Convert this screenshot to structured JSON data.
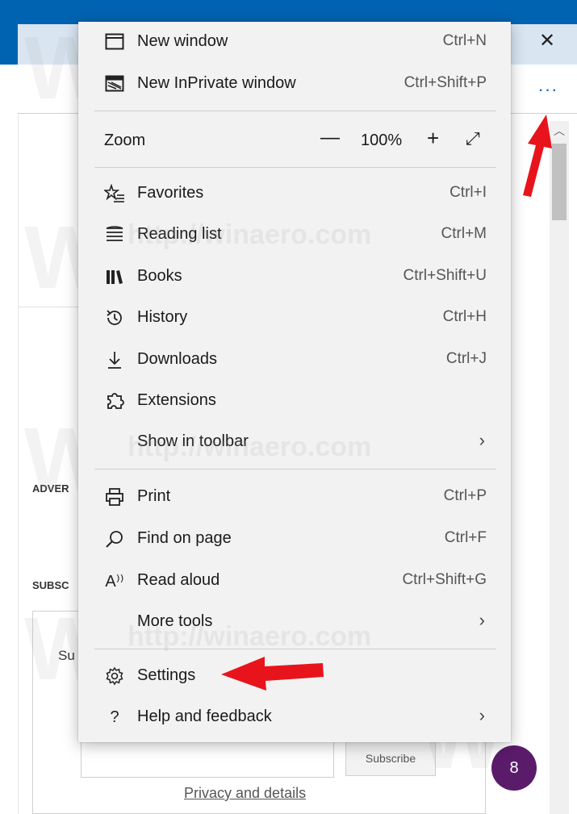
{
  "window": {
    "close_glyph": "✕",
    "more_glyph": "···"
  },
  "page": {
    "adver_label": "ADVER",
    "subsc_label": "SUBSC",
    "sub_text": "Su",
    "subscribe_button": "Subscribe",
    "privacy_link": "Privacy and details",
    "badge_count": "8"
  },
  "watermark": {
    "text": "http://winaero.com",
    "logo_letter": "W"
  },
  "menu": {
    "new_window": {
      "label": "New window",
      "shortcut": "Ctrl+N",
      "icon": "window-icon"
    },
    "new_inprivate": {
      "label": "New InPrivate window",
      "shortcut": "Ctrl+Shift+P",
      "icon": "inprivate-window-icon"
    },
    "zoom": {
      "label": "Zoom",
      "minus": "—",
      "value": "100%",
      "plus": "+",
      "fullscreen": "⤢"
    },
    "favorites": {
      "label": "Favorites",
      "shortcut": "Ctrl+I",
      "icon": "favorites-star-icon"
    },
    "reading_list": {
      "label": "Reading list",
      "shortcut": "Ctrl+M",
      "icon": "reading-list-icon"
    },
    "books": {
      "label": "Books",
      "shortcut": "Ctrl+Shift+U",
      "icon": "books-icon"
    },
    "history": {
      "label": "History",
      "shortcut": "Ctrl+H",
      "icon": "history-icon"
    },
    "downloads": {
      "label": "Downloads",
      "shortcut": "Ctrl+J",
      "icon": "download-icon"
    },
    "extensions": {
      "label": "Extensions",
      "icon": "extensions-icon"
    },
    "show_in_toolbar": {
      "label": "Show in toolbar",
      "chevron": "›"
    },
    "print": {
      "label": "Print",
      "shortcut": "Ctrl+P",
      "icon": "printer-icon"
    },
    "find_on_page": {
      "label": "Find on page",
      "shortcut": "Ctrl+F",
      "icon": "search-icon"
    },
    "read_aloud": {
      "label": "Read aloud",
      "shortcut": "Ctrl+Shift+G",
      "icon_text": "A⁾⁾"
    },
    "more_tools": {
      "label": "More tools",
      "chevron": "›"
    },
    "settings": {
      "label": "Settings",
      "icon": "gear-icon"
    },
    "help": {
      "label": "Help and feedback",
      "icon_text": "?",
      "chevron": "›"
    }
  },
  "colors": {
    "accent": "#0063b1",
    "arrow": "#e8141c",
    "menu_bg": "#f2f2f2",
    "badge": "#5b1b6b"
  }
}
